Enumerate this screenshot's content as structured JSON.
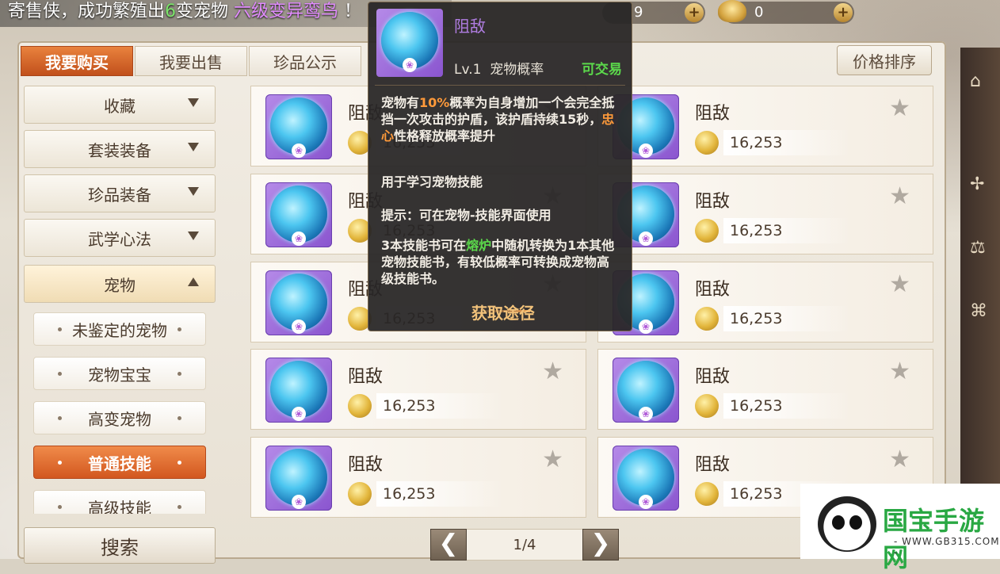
{
  "marquee": {
    "prefix": "寄售侠，成功繁殖出",
    "count": "6",
    "middle": "变宠物",
    "pet_type": "六级变异鸾鸟",
    "suffix": "！"
  },
  "currency": [
    {
      "value": "9"
    },
    {
      "value": "0"
    }
  ],
  "tabs": [
    {
      "label": "我要购买"
    },
    {
      "label": "我要出售"
    },
    {
      "label": "珍品公示"
    }
  ],
  "sort_label": "价格排序",
  "sidebar": {
    "categories": [
      {
        "label": "收藏"
      },
      {
        "label": "套装装备"
      },
      {
        "label": "珍品装备"
      },
      {
        "label": "武学心法"
      },
      {
        "label": "宠物"
      }
    ],
    "subcategories": [
      {
        "label": "未鉴定的宠物"
      },
      {
        "label": "宠物宝宝"
      },
      {
        "label": "高变宠物"
      },
      {
        "label": "普通技能"
      },
      {
        "label": "高级技能"
      }
    ],
    "search_label": "搜索"
  },
  "items": [
    {
      "name": "阻敌",
      "price": "16,253"
    },
    {
      "name": "阻敌",
      "price": "16,253"
    },
    {
      "name": "阻敌",
      "price": "16,253"
    },
    {
      "name": "阻敌",
      "price": "16,253"
    },
    {
      "name": "阻敌",
      "price": "16,253"
    },
    {
      "name": "阻敌",
      "price": "16,253"
    },
    {
      "name": "阻敌",
      "price": "16,253"
    },
    {
      "name": "阻敌",
      "price": "16,253"
    },
    {
      "name": "阻敌",
      "price": "16,253"
    },
    {
      "name": "阻敌",
      "price": "16,253"
    }
  ],
  "pager": {
    "prev": "❮",
    "page": "1/4",
    "next": "❯"
  },
  "tooltip": {
    "title": "阻敌",
    "level": "Lv.1",
    "type": "宠物概率",
    "tradeable": "可交易",
    "desc_a": "宠物有",
    "desc_pct": "10%",
    "desc_b": "概率为自身增加一个会完全抵挡一次攻击的护盾，该护盾持续15秒，",
    "desc_trait": "忠心",
    "desc_c": "性格释放概率提升",
    "usage": "用于学习宠物技能",
    "hint": "提示：可在宠物-技能界面使用",
    "convert_a": "3本技能书可在",
    "convert_place": "熔炉",
    "convert_b": "中随机转换为1本其他宠物技能书，有较低概率可转换成宠物高级技能书。",
    "obtain_label": "获取途径"
  },
  "watermark": {
    "brand": "国宝手游网",
    "site": "- WWW.GB315.COM -"
  },
  "colors": {
    "accent": "#d2571f",
    "tradeable": "#5bd84b",
    "highlight": "#ff9a3a",
    "title_purple": "#b07de2"
  }
}
